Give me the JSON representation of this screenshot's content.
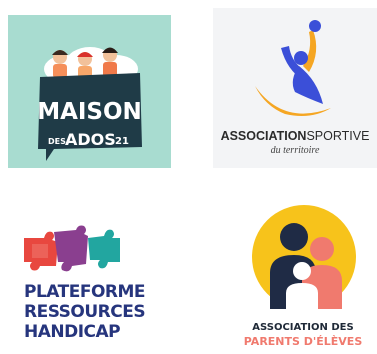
{
  "logos": {
    "maison": {
      "title": "MAISON",
      "des": "DES",
      "ados": "ADOS",
      "number": "21",
      "colors": {
        "background": "#a8dcd0",
        "bubble": "#1f3b47"
      }
    },
    "sportive": {
      "word_bold": "ASSOCIATION",
      "word_light": "SPORTIVE",
      "subtitle": "du territoire",
      "colors": {
        "blue": "#3b4fd8",
        "orange": "#f5a623",
        "background": "#f3f4f6"
      }
    },
    "plateforme": {
      "line1": "PLATEFORME",
      "line2": "RESSOURCES",
      "line3": "HANDICAP",
      "colors": {
        "text": "#26357d",
        "red": "#e8473f",
        "purple": "#8a3f8f",
        "teal": "#22a6a0"
      }
    },
    "parents": {
      "line1": "ASSOCIATION DES",
      "line2": "PARENTS D'ÉLÈVES",
      "colors": {
        "yellow": "#f7c31b",
        "navy": "#1f2b45",
        "coral": "#f07a6e"
      }
    }
  }
}
